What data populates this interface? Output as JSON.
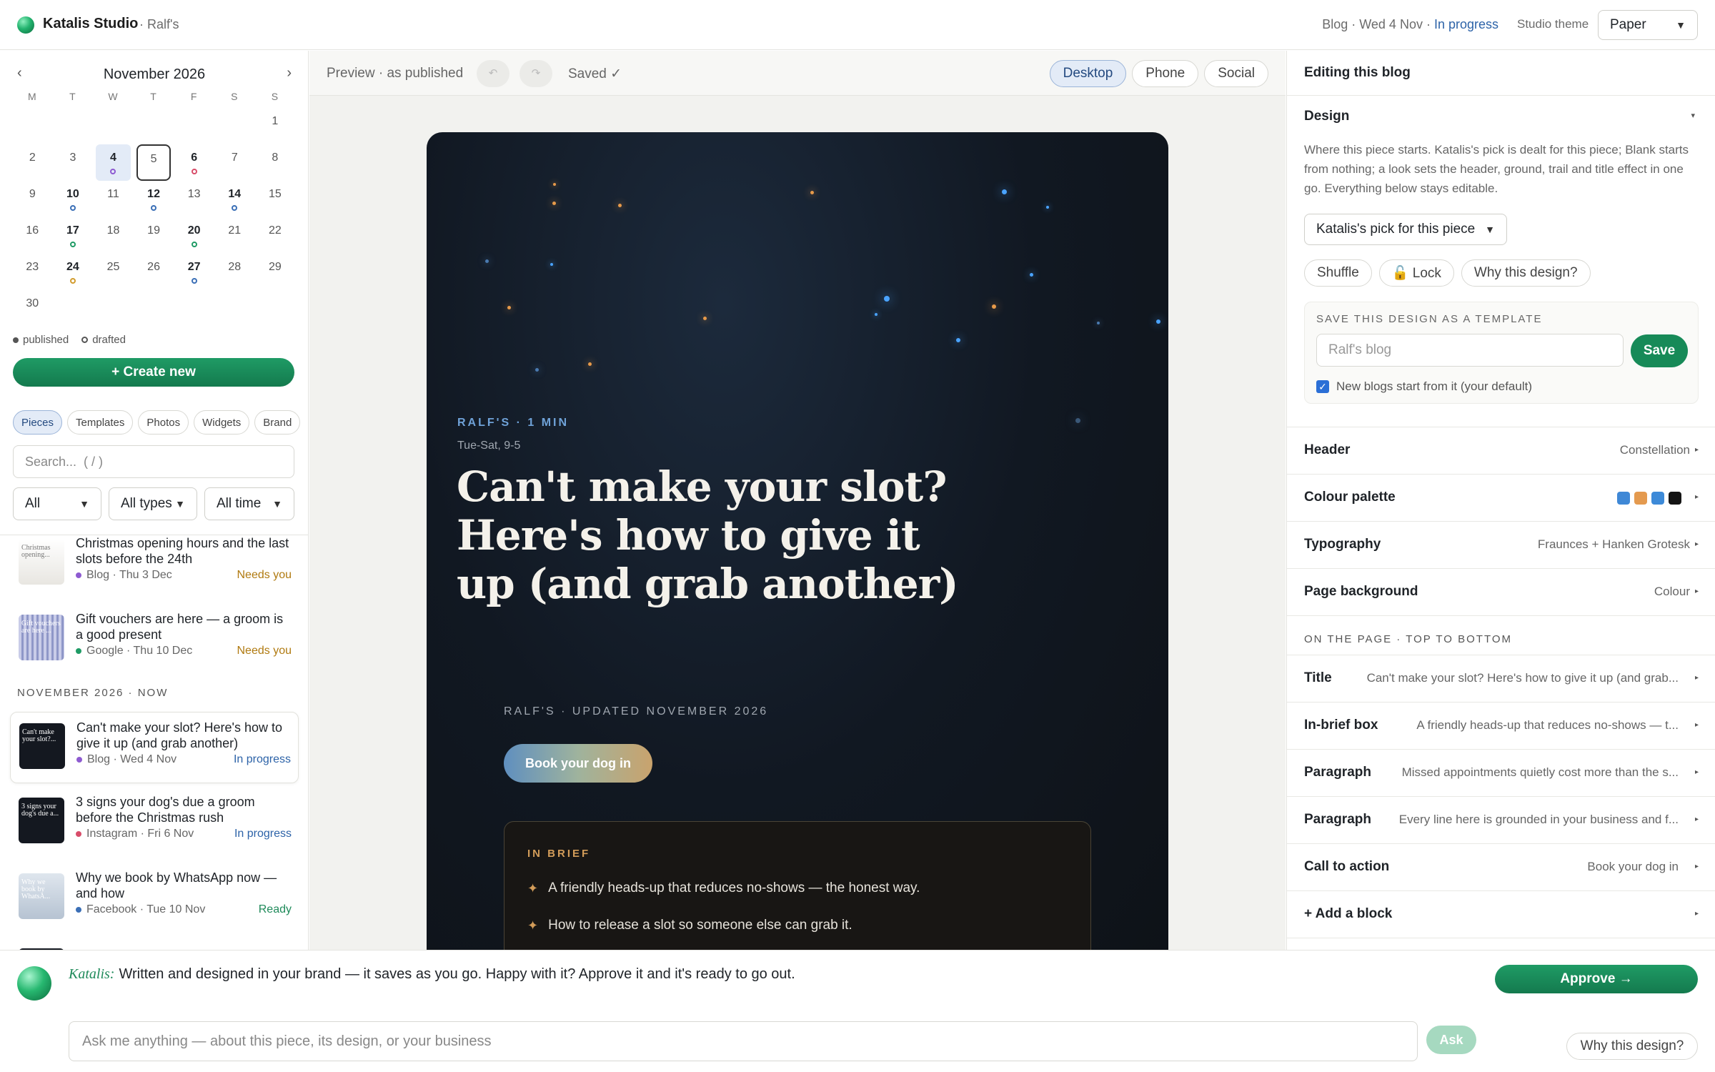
{
  "topbar": {
    "brand": "Katalis Studio",
    "workspace": "· Ralf's",
    "status_prefix": "Blog · Wed 4 Nov · ",
    "status": "In progress",
    "theme_label": "Studio theme",
    "theme_value": "Paper"
  },
  "calendar": {
    "month": "November 2026",
    "prev": "‹",
    "next": "›",
    "dow": [
      "M",
      "T",
      "W",
      "T",
      "F",
      "S",
      "S"
    ],
    "weeks": [
      [
        {
          "d": ""
        },
        {
          "d": ""
        },
        {
          "d": ""
        },
        {
          "d": ""
        },
        {
          "d": ""
        },
        {
          "d": ""
        },
        {
          "d": "1"
        }
      ],
      [
        {
          "d": "2"
        },
        {
          "d": "3"
        },
        {
          "d": "4",
          "dot": "#8e5bd1",
          "sel": true
        },
        {
          "d": "5",
          "today": true
        },
        {
          "d": "6",
          "dot": "#d84d6a"
        },
        {
          "d": "7"
        },
        {
          "d": "8"
        }
      ],
      [
        {
          "d": "9"
        },
        {
          "d": "10",
          "dot": "#3b6fb6"
        },
        {
          "d": "11"
        },
        {
          "d": "12",
          "dot": "#3b6fb6"
        },
        {
          "d": "13"
        },
        {
          "d": "14",
          "dot": "#3b6fb6"
        },
        {
          "d": "15"
        }
      ],
      [
        {
          "d": "16"
        },
        {
          "d": "17",
          "dot": "#1f9b65"
        },
        {
          "d": "18"
        },
        {
          "d": "19"
        },
        {
          "d": "20",
          "dot": "#1f9b65"
        },
        {
          "d": "21"
        },
        {
          "d": "22"
        }
      ],
      [
        {
          "d": "23"
        },
        {
          "d": "24",
          "dot": "#d29c2e"
        },
        {
          "d": "25"
        },
        {
          "d": "26"
        },
        {
          "d": "27",
          "dot": "#3b6fb6"
        },
        {
          "d": "28"
        },
        {
          "d": "29"
        }
      ],
      [
        {
          "d": "30"
        },
        {
          "d": ""
        },
        {
          "d": ""
        },
        {
          "d": ""
        },
        {
          "d": ""
        },
        {
          "d": ""
        },
        {
          "d": ""
        }
      ]
    ],
    "legend_published": "published",
    "legend_drafted": "drafted"
  },
  "sidebar": {
    "create_label": "+ Create new",
    "tabs": [
      "Pieces",
      "Templates",
      "Photos",
      "Widgets",
      "Brand"
    ],
    "search_placeholder": "Search...  ( / )",
    "filters": [
      "All",
      "All types",
      "All time"
    ],
    "section_header": "NOVEMBER 2026 · NOW",
    "items_upcoming": [
      {
        "title": "Christmas opening hours and the last slots before the 24th",
        "meta": "Blog · Thu 3 Dec",
        "status": "Needs you",
        "status_color": "#b07a10",
        "dot": "#8e5bd1",
        "thumb": "light",
        "thumb_text": "Christmas opening..."
      },
      {
        "title": "Gift vouchers are here — a groom is a good present",
        "meta": "Google · Thu 10 Dec",
        "status": "Needs you",
        "status_color": "#b07a10",
        "dot": "#1f9b65",
        "thumb": "striped",
        "thumb_text": "Gift vouchers are here ..."
      }
    ],
    "items_now": [
      {
        "title": "Can't make your slot? Here's how to give it up (and grab another)",
        "meta": "Blog · Wed 4 Nov",
        "status": "In progress",
        "status_color": "#2d63a8",
        "dot": "#8e5bd1",
        "thumb": "dark",
        "thumb_text": "Can't make your slot?...",
        "active": true
      },
      {
        "title": "3 signs your dog's due a groom before the Christmas rush",
        "meta": "Instagram · Fri 6 Nov",
        "status": "In progress",
        "status_color": "#2d63a8",
        "dot": "#d84d6a",
        "thumb": "dark",
        "thumb_text": "3 signs your dog's due a..."
      },
      {
        "title": "Why we book by WhatsApp now — and how",
        "meta": "Facebook · Tue 10 Nov",
        "status": "Ready",
        "status_color": "#1f8a5a",
        "dot": "#3b6fb6",
        "thumb": "mist",
        "thumb_text": "Why we book by WhatsA..."
      }
    ]
  },
  "preview": {
    "label": "Preview · as published",
    "undo": "↶",
    "redo": "↷",
    "saved": "Saved ✓",
    "views": [
      "Desktop",
      "Phone",
      "Social"
    ],
    "eyebrow": "RALF'S · 1 MIN",
    "dateline": "Tue-Sat, 9-5",
    "title": "Can't make your slot? Here's how to give it up (and grab another)",
    "updated": "RALF'S · UPDATED NOVEMBER 2026",
    "cta": "Book your dog in",
    "brief_label": "IN BRIEF",
    "brief_items": [
      "A friendly heads-up that reduces no-shows — the honest way.",
      "How to release a slot so someone else can grab it."
    ]
  },
  "panel": {
    "title": "Editing this blog",
    "design_title": "Design",
    "design_desc": "Where this piece starts. Katalis's pick is dealt for this piece; Blank starts from nothing; a look sets the header, ground, trail and title effect in one go. Everything below stays editable.",
    "pick_value": "Katalis's pick for this piece",
    "buttons": [
      "Shuffle",
      "🔓 Lock",
      "Why this design?"
    ],
    "template_label": "SAVE THIS DESIGN AS A TEMPLATE",
    "template_placeholder": "Ralf's blog",
    "template_save": "Save",
    "template_check": "New blogs start from it (your default)",
    "header_label": "Header",
    "header_value": "Constellation",
    "palette_label": "Colour palette",
    "palette": [
      "#3f88d6",
      "#e49a4f",
      "#3d8ad8",
      "#141414"
    ],
    "typography_label": "Typography",
    "typography_value": "Fraunces + Hanken Grotesk",
    "background_label": "Page background",
    "background_value": "Colour",
    "on_page_caption": "ON THE PAGE · TOP TO BOTTOM",
    "blocks": [
      {
        "label": "Title",
        "desc": "Can't make your slot? Here's how to give it up (and grab..."
      },
      {
        "label": "In-brief box",
        "desc": "A friendly heads-up that reduces no-shows — t..."
      },
      {
        "label": "Paragraph",
        "desc": "Missed appointments quietly cost more than the s..."
      },
      {
        "label": "Paragraph",
        "desc": "Every line here is grounded in your business and f..."
      },
      {
        "label": "Call to action",
        "desc": "Book your dog in"
      }
    ],
    "add_block": "+ Add a block"
  },
  "assistant": {
    "who": "Katalis:",
    "message": "Written and designed in your brand — it saves as you go. Happy with it? Approve it and it's ready to go out.",
    "approve": "Approve →",
    "ask_placeholder": "Ask me anything — about this piece, its design, or your business",
    "ask": "Ask",
    "why": "Why this design?"
  }
}
